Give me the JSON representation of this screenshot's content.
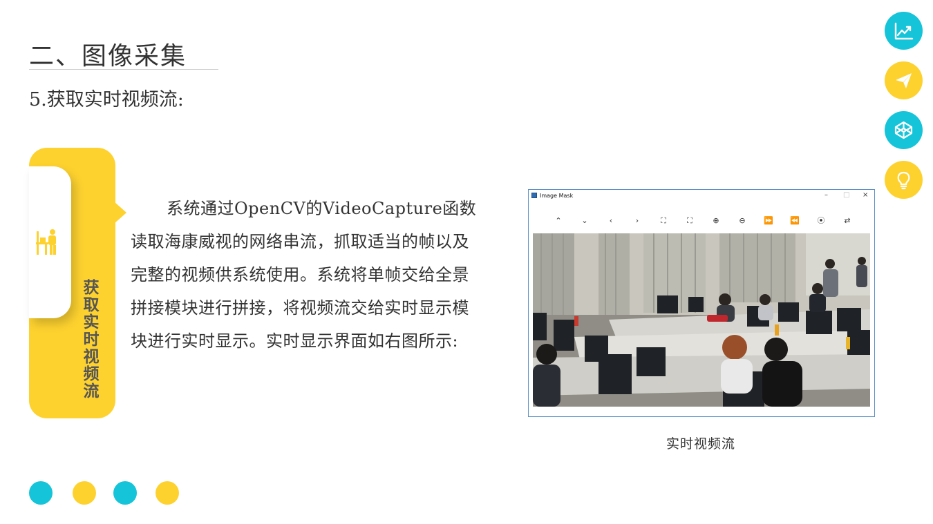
{
  "slide": {
    "title": "二、图像采集",
    "subtitle": "5.获取实时视频流:",
    "tab_label": "获取实时视频流",
    "body": "系统通过OpenCV的VideoCapture函数读取海康威视的网络串流，抓取适当的帧以及完整的视频供系统使用。系统将单帧交给全景拼接模块进行拼接，将视频流交给实时显示模块进行实时显示。实时显示界面如右图所示:",
    "caption": "实时视频流"
  },
  "window": {
    "title": "Image Mask",
    "controls": [
      "–",
      "□",
      "×"
    ],
    "toolbar": [
      {
        "name": "up-arrow-icon",
        "glyph": "⌃"
      },
      {
        "name": "down-arrow-icon",
        "glyph": "⌄"
      },
      {
        "name": "left-arrow-icon",
        "glyph": "‹"
      },
      {
        "name": "right-arrow-icon",
        "glyph": "›"
      },
      {
        "name": "fit-window-icon",
        "glyph": "⛶"
      },
      {
        "name": "fullscreen-icon",
        "glyph": "⛶"
      },
      {
        "name": "zoom-in-icon",
        "glyph": "⊕"
      },
      {
        "name": "zoom-out-icon",
        "glyph": "⊖"
      },
      {
        "name": "fast-forward-icon",
        "glyph": "⏩"
      },
      {
        "name": "rewind-icon",
        "glyph": "⏪"
      },
      {
        "name": "record-icon",
        "glyph": "⦿"
      },
      {
        "name": "swap-icon",
        "glyph": "⇄"
      }
    ]
  },
  "sidebar_icons": [
    {
      "name": "chart-trend-icon",
      "color": "#15c4d9"
    },
    {
      "name": "paper-plane-icon",
      "color": "#fdd22f"
    },
    {
      "name": "codepen-cube-icon",
      "color": "#15c4d9"
    },
    {
      "name": "lightbulb-icon",
      "color": "#fdd22f"
    }
  ],
  "dots": [
    "#15c4d9",
    "#fdd22f",
    "#15c4d9",
    "#fdd22f"
  ],
  "colors": {
    "accent_yellow": "#fdd22f",
    "accent_cyan": "#15c4d9"
  }
}
